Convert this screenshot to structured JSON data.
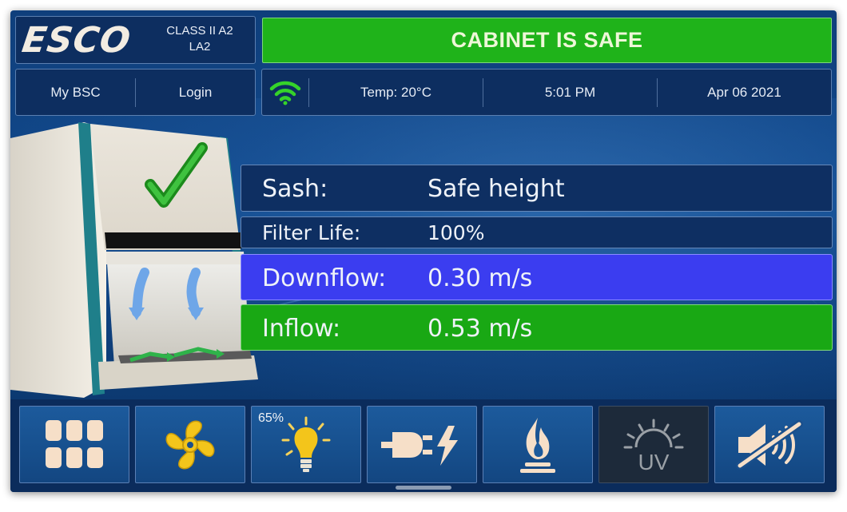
{
  "brand": {
    "logo": "ESCO",
    "class_line1": "CLASS II A2",
    "class_line2": "LA2"
  },
  "banner": {
    "status": "CABINET IS SAFE",
    "color": "#1fb31a"
  },
  "nav": {
    "my_bsc": "My BSC",
    "login": "Login"
  },
  "status": {
    "wifi_icon": "wifi-icon",
    "temp": "Temp: 20°C",
    "time": "5:01 PM",
    "date": "Apr 06 2021"
  },
  "readings": {
    "sash": {
      "label": "Sash:",
      "value": "Safe height"
    },
    "filter": {
      "label": "Filter Life:",
      "value": "100%"
    },
    "downflow": {
      "label": "Downflow:",
      "value": "0.30 m/s",
      "color": "#3b3df0"
    },
    "inflow": {
      "label": "Inflow:",
      "value": "0.53 m/s",
      "color": "#19a814"
    }
  },
  "toolbar": {
    "buttons": [
      {
        "name": "menu-grid",
        "icon": "grid-icon"
      },
      {
        "name": "fan",
        "icon": "fan-icon"
      },
      {
        "name": "light",
        "icon": "light-bulb-icon",
        "level": "65%"
      },
      {
        "name": "power-outlet",
        "icon": "plug-icon"
      },
      {
        "name": "gas",
        "icon": "flame-icon"
      },
      {
        "name": "uv",
        "icon": "uv-icon",
        "text": "UV"
      },
      {
        "name": "alarm-mute",
        "icon": "speaker-mute-icon"
      }
    ]
  }
}
